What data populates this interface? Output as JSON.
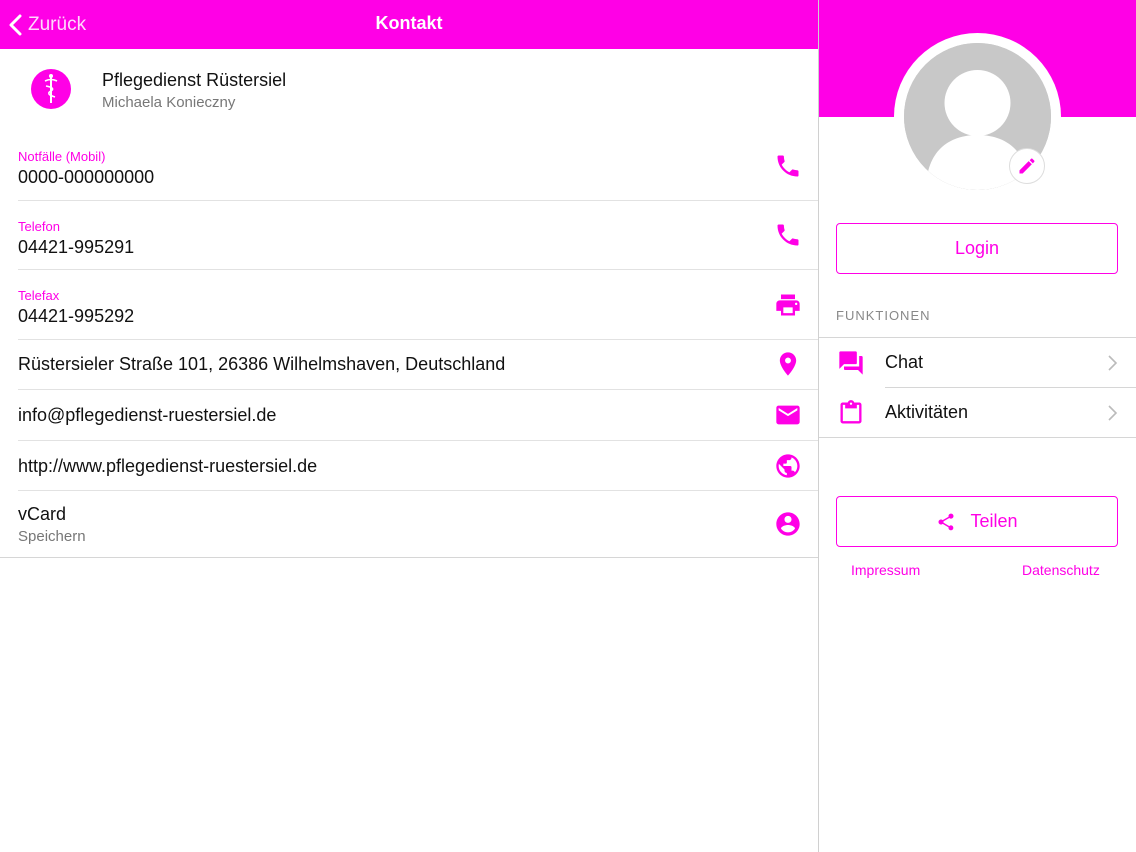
{
  "colors": {
    "accent": "#ff00e6",
    "avatar_gray": "#c8c8c8"
  },
  "navbar": {
    "back_label": "Zurück",
    "title": "Kontakt"
  },
  "organization": {
    "name": "Pflegedienst Rüstersiel",
    "person": "Michaela Konieczny",
    "logo_icon": "caduceus-icon"
  },
  "contact": {
    "emergency": {
      "label": "Notfälle (Mobil)",
      "value": "0000-000000000",
      "icon": "phone-icon"
    },
    "phone": {
      "label": "Telefon",
      "value": "04421-995291",
      "icon": "phone-icon"
    },
    "fax": {
      "label": "Telefax",
      "value": "04421-995292",
      "icon": "printer-icon"
    },
    "address": {
      "value": "Rüstersieler Straße 101, 26386 Wilhelmshaven, Deutschland",
      "icon": "map-pin-icon"
    },
    "email": {
      "value": "info@pflegedienst-ruestersiel.de",
      "icon": "mail-icon"
    },
    "website": {
      "value": "http://www.pflegedienst-ruestersiel.de",
      "icon": "globe-icon"
    },
    "vcard": {
      "value": "vCard",
      "sub": "Speichern",
      "icon": "account-circle-icon"
    }
  },
  "sidebar": {
    "login_label": "Login",
    "section_title": "FUNKTIONEN",
    "menu": [
      {
        "label": "Chat",
        "icon": "chat-icon"
      },
      {
        "label": "Aktivitäten",
        "icon": "clipboard-icon"
      }
    ],
    "share_label": "Teilen",
    "impressum_label": "Impressum",
    "privacy_label": "Datenschutz"
  }
}
